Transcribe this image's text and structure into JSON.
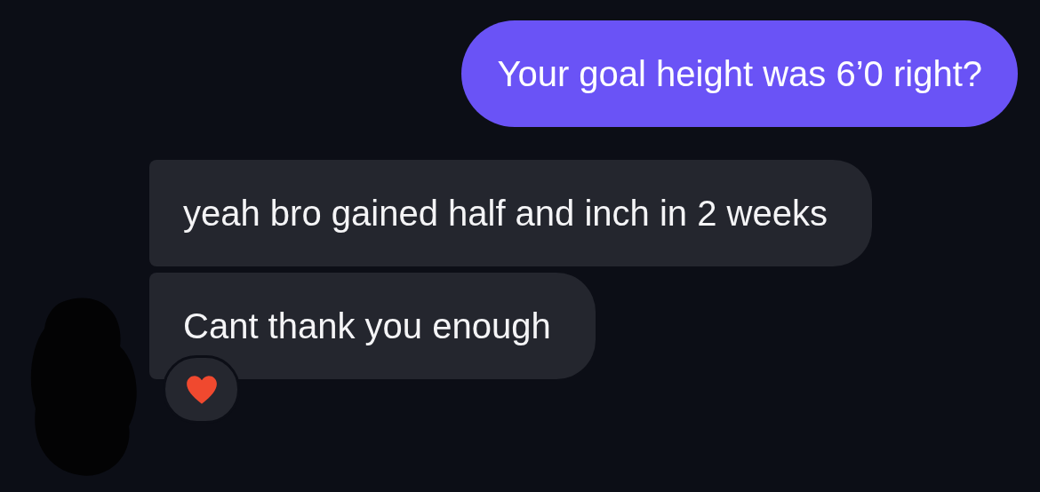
{
  "messages": [
    {
      "kind": "outgoing",
      "text": "Your goal height was 6’0 right?"
    },
    {
      "kind": "incoming",
      "text": "yeah bro gained half and inch in 2 weeks"
    },
    {
      "kind": "incoming",
      "text": "Cant thank you enough",
      "reaction": {
        "kind": "heart"
      }
    }
  ]
}
